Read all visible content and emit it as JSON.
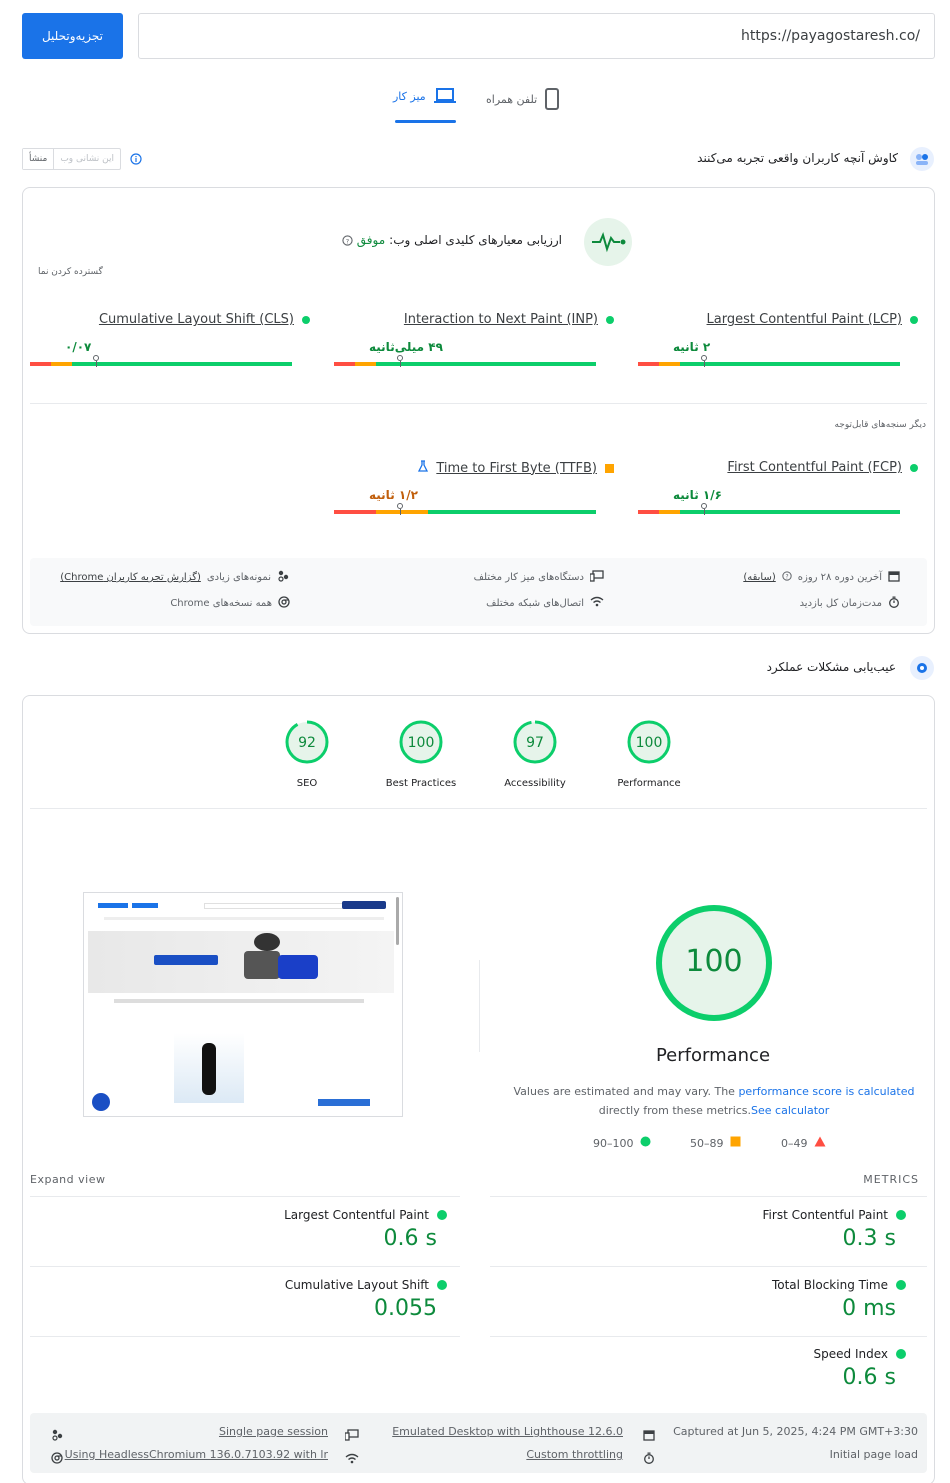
{
  "header": {
    "url": "https://payagostaresh.co/",
    "analyze_label": "تجزیه‌وتحلیل"
  },
  "tabs": [
    {
      "label": "تلفن همراه",
      "icon": "phone-icon"
    },
    {
      "label": "میز کار",
      "icon": "laptop-icon"
    }
  ],
  "crux": {
    "title": "کاوش آنچه کاربران واقعی تجربه می‌کنند",
    "toggle_this_url": "این نشانی وب",
    "toggle_origin": "منشأ",
    "assessment_label": "ارزیابی معیارهای کلیدی اصلی وب:",
    "assessment_result": "موفق",
    "expand_label": "گسترده کردن نما",
    "metrics": [
      {
        "name": "Largest Contentful Paint (LCP)",
        "value": "۲ ثانیه",
        "status": "good",
        "marker": 0.25
      },
      {
        "name": "Interaction to Next Paint (INP)",
        "value": "۴۹ میلی‌ثانیه",
        "status": "good",
        "marker": 0.25
      },
      {
        "name": "Cumulative Layout Shift (CLS)",
        "value": "۰/۰۷",
        "status": "good",
        "marker": 0.25
      }
    ],
    "other_label": "دیگر سنجه‌های قابل‌توجه",
    "other_metrics": [
      {
        "name": "First Contentful Paint (FCP)",
        "value": "۱/۶ ثانیه",
        "status": "good",
        "marker": 0.25
      },
      {
        "name": "Time to First Byte (TTFB)",
        "value": "۱/۲ ثانیه",
        "status": "average",
        "marker": 0.25
      }
    ],
    "info": [
      {
        "icon": "calendar-icon",
        "text": "آخرین دوره ۲۸ روزه",
        "link": "(سابقه)"
      },
      {
        "icon": "devices-icon",
        "text": "دستگاه‌های میز کار مختلف"
      },
      {
        "icon": "users-icon",
        "text": "نمونه‌های زیادی",
        "link": "(گزارش تجربه کاربران Chrome)"
      },
      {
        "icon": "stopwatch-icon",
        "text": "مدت‌زمان کل بازدید"
      },
      {
        "icon": "wifi-icon",
        "text": "اتصال‌های شبکه مختلف"
      },
      {
        "icon": "chrome-icon",
        "text": "همه نسخه‌های Chrome"
      }
    ]
  },
  "lighthouse": {
    "title": "عیب‌یابی مشکلات عملکرد",
    "scores": [
      {
        "label": "Performance",
        "score": 100
      },
      {
        "label": "Accessibility",
        "score": 97
      },
      {
        "label": "Best Practices",
        "score": 100
      },
      {
        "label": "SEO",
        "score": 92
      }
    ],
    "main_score": 100,
    "main_label": "Performance",
    "note_prefix": "Values are estimated and may vary. The",
    "note_link": "performance score is calculated",
    "note_mid": "directly from these metrics.",
    "note_link2": "See calculator",
    "legend": [
      {
        "range": "90–100",
        "shape": "circle",
        "color": "#0cce6b"
      },
      {
        "range": "50–89",
        "shape": "square",
        "color": "#ffa400"
      },
      {
        "range": "0–49",
        "shape": "triangle",
        "color": "#ff4e42"
      }
    ],
    "metrics_label": "METRICS",
    "expand_label": "Expand view",
    "metrics": [
      {
        "name": "First Contentful Paint",
        "value": "0.3 s"
      },
      {
        "name": "Largest Contentful Paint",
        "value": "0.6 s"
      },
      {
        "name": "Total Blocking Time",
        "value": "0 ms"
      },
      {
        "name": "Cumulative Layout Shift",
        "value": "0.055"
      },
      {
        "name": "Speed Index",
        "value": "0.6 s"
      }
    ],
    "footer": [
      {
        "icon": "calendar-icon",
        "text": "Captured at Jun 5, 2025, 4:24 PM GMT+3:30"
      },
      {
        "icon": "devices-icon",
        "text": "Emulated Desktop with Lighthouse 12.6.0"
      },
      {
        "icon": "users-icon",
        "text": "Single page session"
      },
      {
        "icon": "stopwatch-icon",
        "text": "Initial page load"
      },
      {
        "icon": "wifi-icon",
        "text": "Custom throttling"
      },
      {
        "icon": "chrome-icon",
        "text": "Using HeadlessChromium 136.0.7103.92 with lr"
      }
    ]
  },
  "colors": {
    "good": "#0cce6b",
    "average": "#ffa400",
    "poor": "#ff4e42",
    "accent": "#1a73e8"
  }
}
